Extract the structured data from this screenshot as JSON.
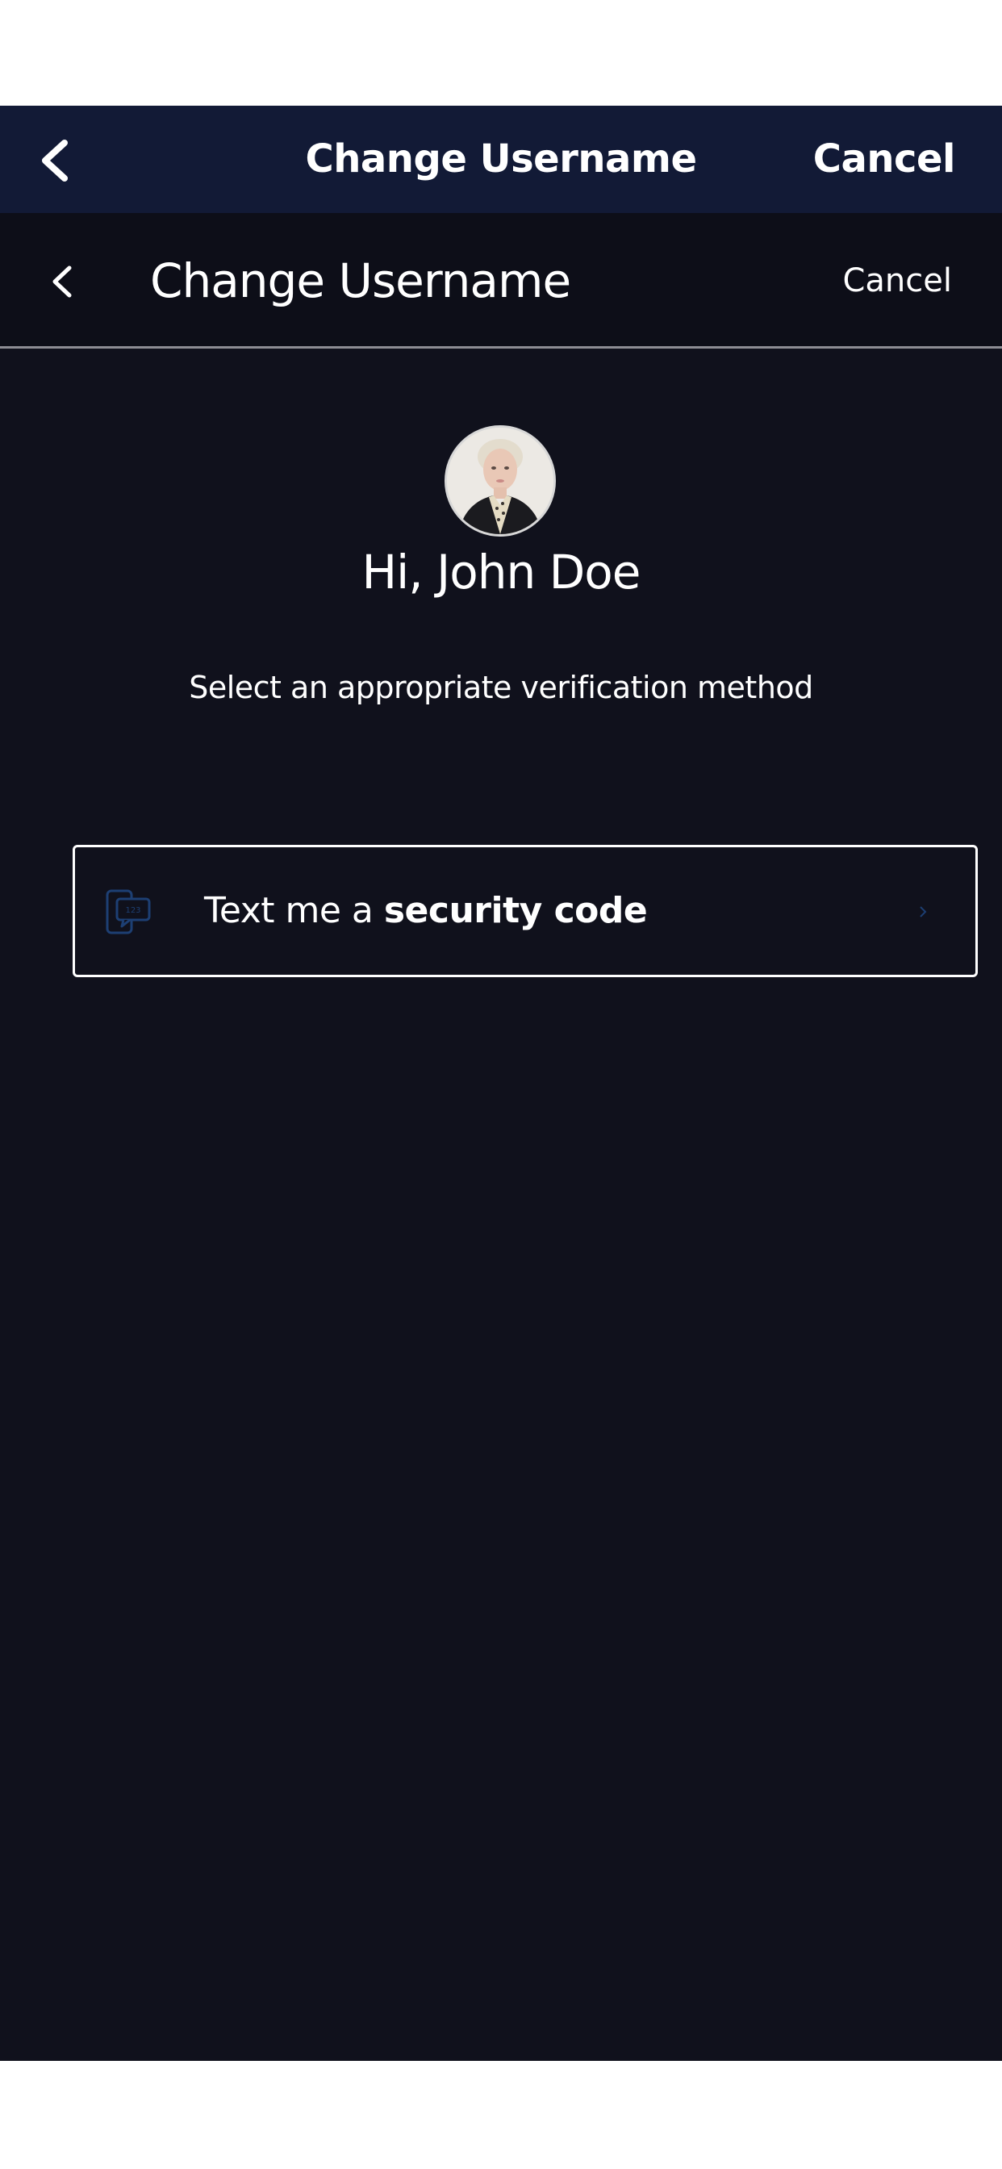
{
  "top_nav": {
    "title": "Change Username",
    "cancel_label": "Cancel"
  },
  "sub_header": {
    "title": "Change Username",
    "cancel_label": "Cancel"
  },
  "profile": {
    "greeting": "Hi, John Doe",
    "avatar_icon": "user-avatar-photo"
  },
  "instruction": "Select an appropriate verification method",
  "options": [
    {
      "label_prefix": "Text me a ",
      "label_bold": "security code",
      "icon": "sms-code-icon",
      "chevron_icon": "chevron-right-icon"
    }
  ],
  "colors": {
    "top_nav_bg": "#121a36",
    "screen_bg": "#10111c",
    "icon_accent": "#1d3f73",
    "text": "#ffffff"
  }
}
